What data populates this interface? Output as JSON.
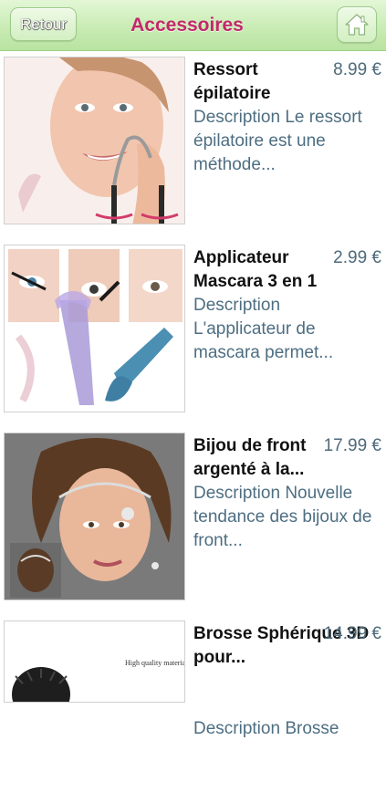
{
  "header": {
    "back_label": "Retour",
    "title": "Accessoires",
    "home_icon": "home-icon"
  },
  "products": [
    {
      "name": "Ressort épilatoire",
      "price": "8.99 €",
      "description": "Description Le ressort épilatoire est une méthode..."
    },
    {
      "name": "Applicateur Mascara 3 en 1",
      "price": "2.99 €",
      "description": "Description L'applicateur de mascara permet..."
    },
    {
      "name": "Bijou de front argenté à la...",
      "price": "17.99 €",
      "description": "Description Nouvelle tendance des bijoux de front..."
    },
    {
      "name": "Brosse Sphérique 3D pour...",
      "price": "14.99 €",
      "description": "Description Brosse",
      "image_caption": "High quality material"
    }
  ],
  "colors": {
    "header_green": "#c9ecb4",
    "title_pink": "#c4276b",
    "description_blue": "#4d6e82"
  }
}
